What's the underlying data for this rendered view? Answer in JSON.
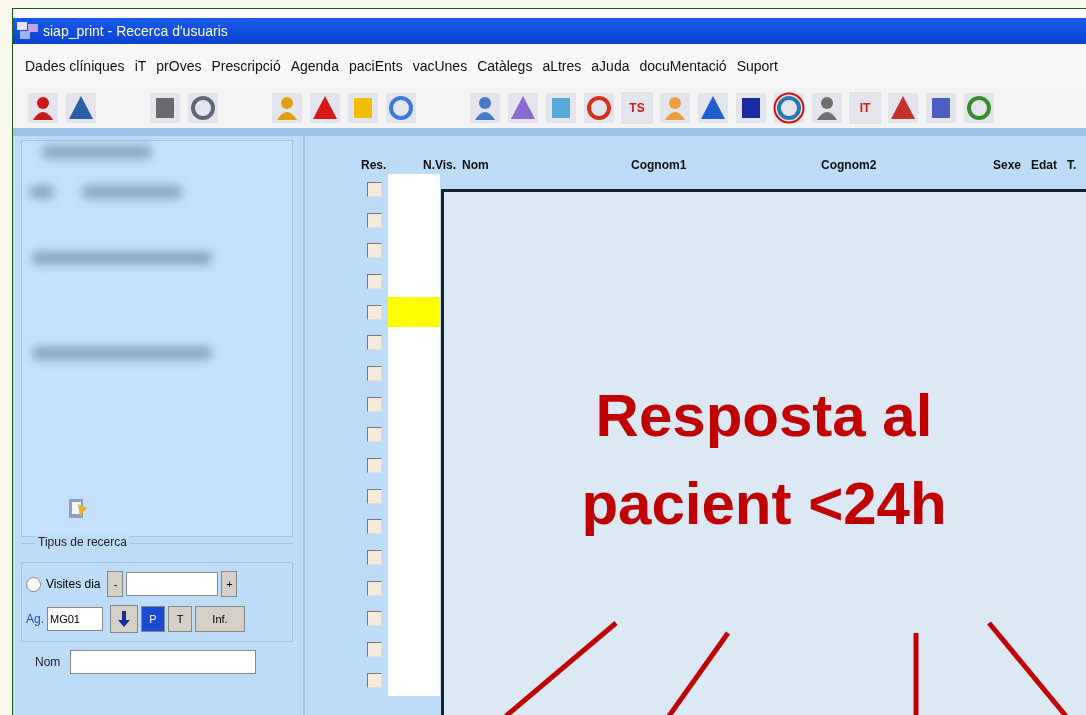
{
  "window": {
    "title": "siap_print - Recerca d'usuaris"
  },
  "menu": [
    "Dades clíniques",
    "iT",
    "prOves",
    "Prescripció",
    "Agenda",
    "paciEnts",
    "vacUnes",
    "Catàlegs",
    "aLtres",
    "aJuda",
    "docuMentació",
    "Suport"
  ],
  "toolbar": [
    {
      "kind": "icon",
      "circled": false
    },
    {
      "kind": "icon",
      "circled": false
    },
    {
      "kind": "gap"
    },
    {
      "kind": "icon",
      "circled": false
    },
    {
      "kind": "icon",
      "circled": false
    },
    {
      "kind": "gap"
    },
    {
      "kind": "icon",
      "circled": false
    },
    {
      "kind": "icon",
      "circled": false
    },
    {
      "kind": "icon",
      "circled": false
    },
    {
      "kind": "icon",
      "circled": false
    },
    {
      "kind": "gap"
    },
    {
      "kind": "icon",
      "circled": false
    },
    {
      "kind": "icon",
      "circled": false
    },
    {
      "kind": "icon",
      "circled": false
    },
    {
      "kind": "icon",
      "circled": false
    },
    {
      "kind": "text",
      "label": "TS",
      "circled": false
    },
    {
      "kind": "icon",
      "circled": false
    },
    {
      "kind": "icon",
      "circled": false
    },
    {
      "kind": "icon",
      "circled": false
    },
    {
      "kind": "icon",
      "circled": true
    },
    {
      "kind": "icon",
      "circled": false
    },
    {
      "kind": "text",
      "label": "IT",
      "circled": false
    },
    {
      "kind": "icon",
      "circled": false
    },
    {
      "kind": "icon",
      "circled": false
    },
    {
      "kind": "icon",
      "circled": false
    }
  ],
  "search_type": {
    "title": "Tipus de recerca",
    "radio": {
      "label": "Visites dia",
      "selected": false
    },
    "minus": "-",
    "plus": "+",
    "ag_label": "Ag.",
    "ag_value": "MG01",
    "p_button": {
      "label": "P",
      "selected": true
    },
    "t_button": {
      "label": "T",
      "selected": false
    },
    "inf_button": "Inf.",
    "name_label": "Nom"
  },
  "table": {
    "columns": [
      "Res.",
      "N.Vis.",
      "Nom",
      "Cognom1",
      "Cognom2",
      "Sexe",
      "Edat",
      "T."
    ],
    "rows": [
      {
        "checked": false,
        "selected": false
      },
      {
        "checked": false,
        "selected": false
      },
      {
        "checked": false,
        "selected": false
      },
      {
        "checked": false,
        "selected": false
      },
      {
        "checked": false,
        "selected": true
      },
      {
        "checked": false,
        "selected": false
      },
      {
        "checked": false,
        "selected": false
      },
      {
        "checked": false,
        "selected": false
      },
      {
        "checked": false,
        "selected": false
      },
      {
        "checked": false,
        "selected": false
      },
      {
        "checked": false,
        "selected": false
      },
      {
        "checked": false,
        "selected": false
      },
      {
        "checked": false,
        "selected": false
      },
      {
        "checked": false,
        "selected": false
      },
      {
        "checked": false,
        "selected": false
      },
      {
        "checked": false,
        "selected": false
      },
      {
        "checked": false,
        "selected": false
      }
    ]
  },
  "callout": {
    "text": "Resposta al pacient <24h"
  }
}
